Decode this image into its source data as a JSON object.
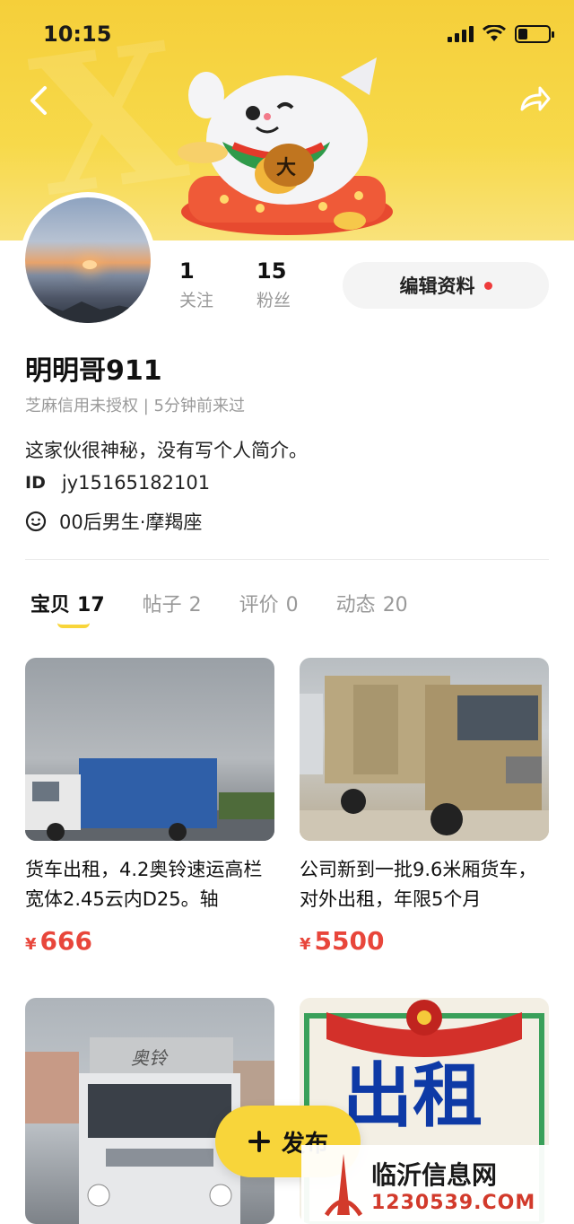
{
  "status_bar": {
    "time": "10:15"
  },
  "profile": {
    "following_count": "1",
    "following_label": "关注",
    "followers_count": "15",
    "followers_label": "粉丝",
    "edit_label": "编辑资料",
    "username": "明明哥911",
    "credit_line": "芝麻信用未授权 | 5分钟前来过",
    "bio": "这家伙很神秘，没有写个人简介。",
    "id_key": "ID",
    "id_value": "jy15165182101",
    "tag_text": "00后男生·摩羯座"
  },
  "tabs": [
    {
      "label": "宝贝",
      "count": "17"
    },
    {
      "label": "帖子",
      "count": "2"
    },
    {
      "label": "评价",
      "count": "0"
    },
    {
      "label": "动态",
      "count": "20"
    }
  ],
  "items": [
    {
      "title": "货车出租，4.2奥铃速运高栏宽体2.45云内D25。轴",
      "currency": "¥",
      "price": "666"
    },
    {
      "title": "公司新到一批9.6米厢货车，对外出租，年限5个月",
      "currency": "¥",
      "price": "5500"
    },
    {
      "image_text": "奥铃"
    },
    {
      "image_text": "出租"
    }
  ],
  "fab": {
    "label": "发布"
  },
  "watermark": {
    "name": "临沂信息网",
    "domain": "1230539.COM"
  },
  "colors": {
    "accent": "#f8d53a",
    "price": "#e8463b"
  }
}
